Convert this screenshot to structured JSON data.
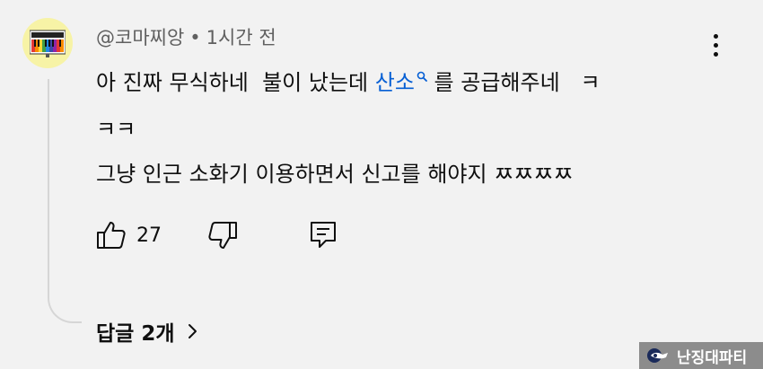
{
  "comment": {
    "author": "@코마찌앙",
    "separator": "•",
    "timestamp": "1시간 전",
    "text_line1_before": "아 진짜 무식하네  불이 났는데 ",
    "search_term": "산소",
    "text_line1_after": " 를 공급해주네   ㅋ",
    "text_line2": "ㅋㅋ",
    "text_line3": "그냥 인근 소화기 이용하면서 신고를 해야지 ㅉㅉㅉㅉ",
    "like_count": "27",
    "replies_label": "답글 2개"
  },
  "watermark": {
    "text": "난징대파티"
  },
  "colors": {
    "background": "#f2f2f2",
    "link": "#065fd4",
    "meta": "#606060",
    "avatar_bg": "#f7f3a6"
  },
  "icons": {
    "like": "thumbs-up-icon",
    "dislike": "thumbs-down-icon",
    "reply": "comment-reply-icon",
    "more": "more-vert-icon",
    "replies_chevron": "chevron-right-icon",
    "search": "search-icon"
  }
}
